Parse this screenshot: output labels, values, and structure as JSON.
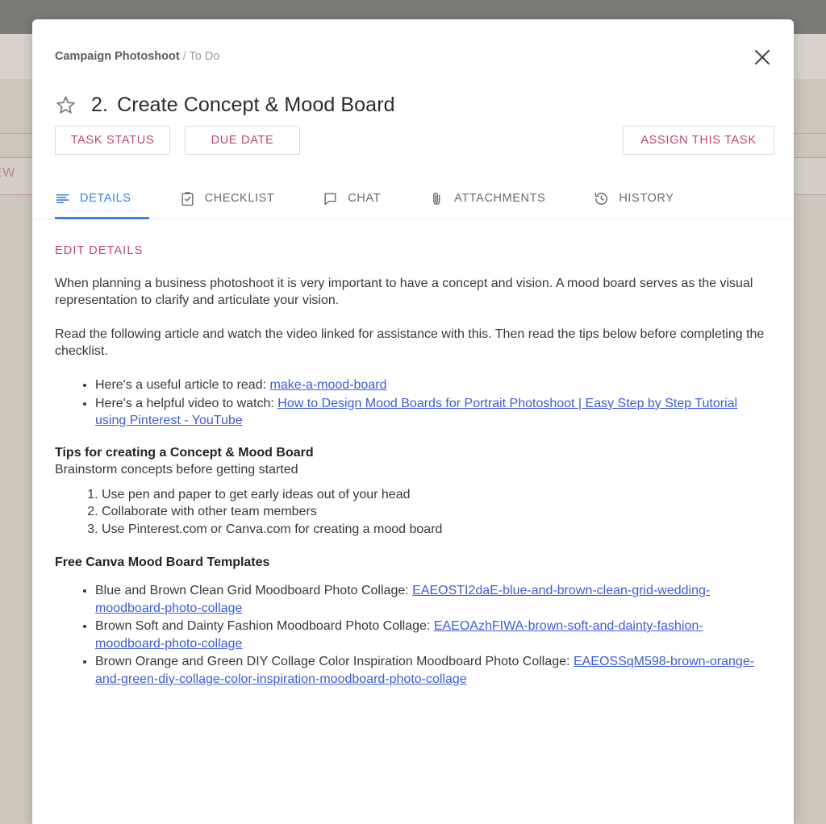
{
  "backdrop": {
    "new_label": "NEW"
  },
  "modal": {
    "breadcrumb": {
      "project": "Campaign Photoshoot",
      "separator": "/",
      "status": "To Do"
    },
    "close_icon": "close-icon",
    "star_icon": "star-outline-icon",
    "task_number": "2.",
    "task_title": "Create Concept & Mood Board",
    "buttons": {
      "task_status": "TASK STATUS",
      "due_date": "DUE DATE",
      "assign": "ASSIGN THIS TASK"
    },
    "tabs": [
      {
        "label": "DETAILS",
        "icon": "details-lines-icon",
        "active": true
      },
      {
        "label": "CHECKLIST",
        "icon": "clipboard-check-icon",
        "active": false
      },
      {
        "label": "CHAT",
        "icon": "speech-bubble-icon",
        "active": false
      },
      {
        "label": "ATTACHMENTS",
        "icon": "paperclip-icon",
        "active": false
      },
      {
        "label": "HISTORY",
        "icon": "clock-history-icon",
        "active": false
      }
    ],
    "accent_color": "#c2456a",
    "active_tab_color": "#3b82e8",
    "link_color": "#3b5cdb"
  },
  "details": {
    "edit_link": "EDIT DETAILS",
    "paragraph_1": "When planning a business photoshoot it is very important to have a concept and vision. A mood board serves as the visual representation to clarify and articulate your vision.",
    "paragraph_2": "Read the following article and watch the video linked for assistance with this. Then read the tips below before completing the checklist.",
    "resources": [
      {
        "prefix": "Here's a useful article to read: ",
        "link_text": "make-a-mood-board"
      },
      {
        "prefix": "Here's a helpful video to watch: ",
        "link_text": "How to Design Mood Boards for Portrait Photoshoot | Easy Step by Step Tutorial using Pinterest - YouTube"
      }
    ],
    "tips_heading": "Tips for creating a Concept & Mood Board",
    "tips_subline": "Brainstorm concepts before getting started",
    "tips": [
      "Use pen and paper to get early ideas out of your head",
      "Collaborate with other team members",
      "Use Pinterest.com or Canva.com for creating a mood board"
    ],
    "templates_heading": "Free Canva Mood Board Templates",
    "templates": [
      {
        "prefix": "Blue and Brown Clean Grid Moodboard Photo Collage: ",
        "link_text": "EAEOSTI2daE-blue-and-brown-clean-grid-wedding-moodboard-photo-collage"
      },
      {
        "prefix": "Brown Soft and Dainty Fashion Moodboard Photo Collage: ",
        "link_text": "EAEOAzhFIWA-brown-soft-and-dainty-fashion-moodboard-photo-collage"
      },
      {
        "prefix": "Brown Orange and Green DIY Collage Color Inspiration Moodboard Photo Collage: ",
        "link_text": "EAEOSSqM598-brown-orange-and-green-diy-collage-color-inspiration-moodboard-photo-collage"
      }
    ]
  }
}
